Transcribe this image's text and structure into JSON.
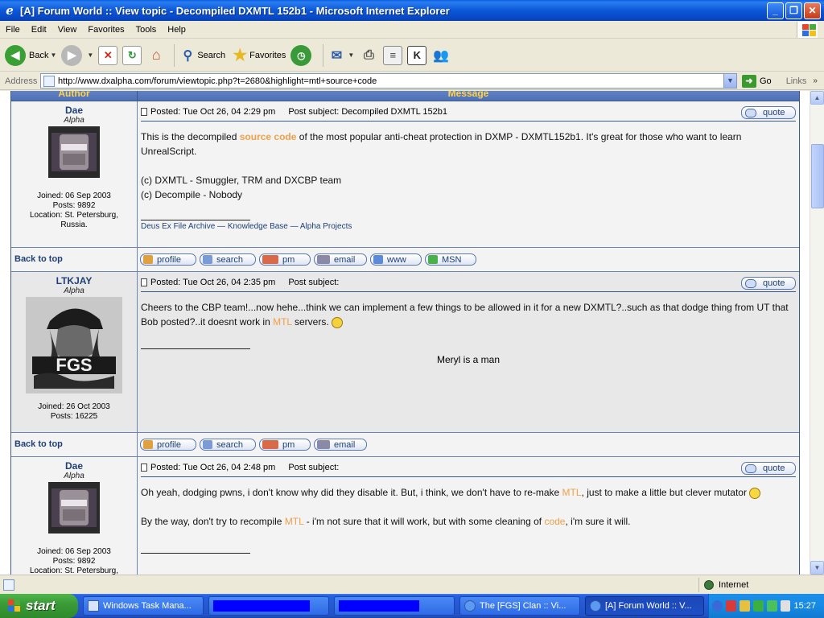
{
  "window": {
    "title": "[A] Forum World :: View topic - Decompiled DXMTL 152b1 - Microsoft Internet Explorer",
    "minimize": "_",
    "maximize": "❐",
    "close": "✕"
  },
  "menu": [
    "File",
    "Edit",
    "View",
    "Favorites",
    "Tools",
    "Help"
  ],
  "toolbar": {
    "back_label": "Back",
    "search_label": "Search",
    "favorites_label": "Favorites"
  },
  "address": {
    "label": "Address",
    "url": "http://www.dxalpha.com/forum/viewtopic.php?t=2680&highlight=mtl+source+code",
    "go_label": "Go",
    "links_label": "Links"
  },
  "forum": {
    "header_author": "Author",
    "header_message": "Message",
    "back_to_top": "Back to top",
    "quote_label": "quote",
    "buttons_full": [
      "profile",
      "search",
      "pm",
      "email",
      "www",
      "MSN"
    ],
    "buttons_short": [
      "profile",
      "search",
      "pm",
      "email"
    ],
    "posts": [
      {
        "author": "Dae",
        "rank": "Alpha",
        "info": [
          "Joined: 06 Sep 2003",
          "Posts: 9892",
          "Location: St. Petersburg,",
          "Russia."
        ],
        "posted": "Posted: Tue Oct 26, 04 2:29 pm",
        "subject": "Post subject: Decompiled DXMTL 152b1",
        "body_1a": "This is the decompiled ",
        "body_1b": "source code",
        "body_1c": " of the most popular anti-cheat protection in DXMP - DXMTL152b1. It's great for those who want to learn UnrealScript.",
        "body_2": "(c) DXMTL - Smuggler, TRM and DXCBP team",
        "body_3": "(c) Decompile - Nobody",
        "signature": "Deus Ex File Archive — Knowledge Base — Alpha Projects"
      },
      {
        "author": "LTKJAY",
        "rank": "Alpha",
        "info": [
          "Joined: 26 Oct 2003",
          "Posts: 16225"
        ],
        "posted": "Posted: Tue Oct 26, 04 2:35 pm",
        "subject": "Post subject:",
        "body_1a": "Cheers to the CBP team!...now hehe...think we can implement a few things to be allowed in it for a new DXMTL?..such as that dodge thing from UT that Bob posted?..it doesnt work in ",
        "body_1b": "MTL",
        "body_1c": " servers.",
        "signature": "Meryl is a man"
      },
      {
        "author": "Dae",
        "rank": "Alpha",
        "info": [
          "Joined: 06 Sep 2003",
          "Posts: 9892",
          "Location: St. Petersburg,"
        ],
        "posted": "Posted: Tue Oct 26, 04 2:48 pm",
        "subject": "Post subject:",
        "body_1a": "Oh yeah, dodging pwns, i don't know why did they disable it. But, i think, we don't have to re-make ",
        "body_1b": "MTL",
        "body_1c": ", just to make a little but clever mutator",
        "body_2a": "By the way, don't try to recompile ",
        "body_2b": "MTL",
        "body_2c": " - i'm not sure that it will work, but with some cleaning of ",
        "body_2d": "code",
        "body_2e": ", i'm sure it will."
      }
    ]
  },
  "status": {
    "zone": "Internet"
  },
  "taskbar": {
    "start": "start",
    "tasks": [
      "Windows Task Mana...",
      "",
      "",
      "The [FGS] Clan :: Vi...",
      "[A] Forum World :: V..."
    ],
    "clock": "15:27"
  },
  "colors": {
    "highlight": "#f0a04a",
    "link": "#1e3f78",
    "header_text": "#ffd34a"
  }
}
